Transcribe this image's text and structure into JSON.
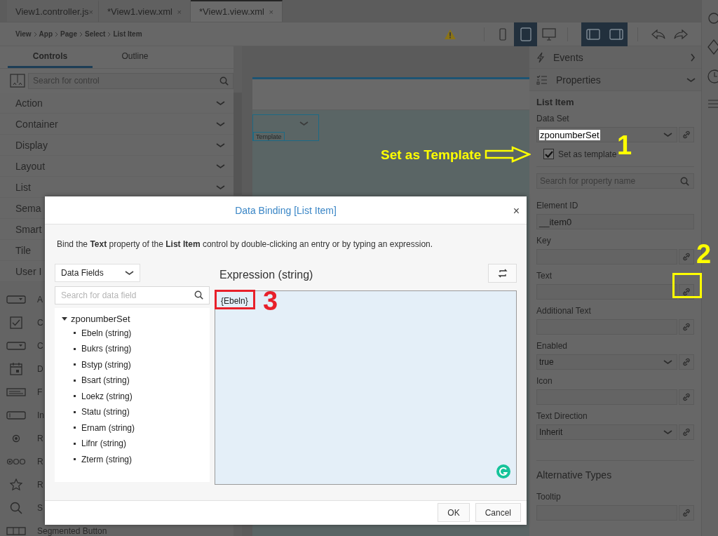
{
  "editor_tabs": [
    {
      "label": "View1.controller.js",
      "close": "×",
      "selected": false
    },
    {
      "label": "*View1.view.xml",
      "close": "×",
      "selected": false
    },
    {
      "label": "*View1.view.xml",
      "close": "×",
      "selected": true
    }
  ],
  "breadcrumb": [
    "View",
    "App",
    "Page",
    "Select",
    "List Item"
  ],
  "toolbar": {
    "devices": [
      {
        "kind": "phone",
        "selected": false
      },
      {
        "kind": "tablet",
        "selected": true
      },
      {
        "kind": "desktop",
        "selected": false
      }
    ],
    "panes": [
      {
        "kind": "left",
        "selected": true
      },
      {
        "kind": "right",
        "selected": true
      }
    ]
  },
  "left_panel": {
    "tabs": [
      {
        "label": "Controls",
        "selected": true
      },
      {
        "label": "Outline",
        "selected": false
      }
    ],
    "search": {
      "placeholder": "Search for control"
    },
    "categories": [
      {
        "label": "Action",
        "chevron": true
      },
      {
        "label": "Container",
        "chevron": true
      },
      {
        "label": "Display",
        "chevron": true
      },
      {
        "label": "Layout",
        "chevron": true
      },
      {
        "label": "List",
        "chevron": true
      },
      {
        "label": "Sema",
        "chevron": false
      },
      {
        "label": "Smart",
        "chevron": false
      },
      {
        "label": "Tile",
        "chevron": false
      },
      {
        "label": "User I",
        "chevron": false
      }
    ],
    "controls": [
      {
        "kind": "select",
        "label": "A"
      },
      {
        "kind": "checkbox",
        "label": "C"
      },
      {
        "kind": "select",
        "label": "C"
      },
      {
        "kind": "date",
        "label": "D"
      },
      {
        "kind": "feed",
        "label": "F"
      },
      {
        "kind": "input",
        "label": "In"
      },
      {
        "kind": "radio",
        "label": "R"
      },
      {
        "kind": "radio-group",
        "label": "R"
      },
      {
        "kind": "rating",
        "label": "R"
      },
      {
        "kind": "search",
        "label": "S"
      },
      {
        "kind": "segmented",
        "label": "Segmented Button"
      }
    ]
  },
  "canvas": {
    "template_label": "Template"
  },
  "properties_panel": {
    "sections": [
      {
        "kind": "events",
        "label": "Events",
        "expanded": false
      },
      {
        "kind": "properties",
        "label": "Properties",
        "expanded": true
      }
    ],
    "heading": "List Item",
    "data_set": {
      "label": "Data Set",
      "value": "zponumberSet"
    },
    "template_checkbox": {
      "label": "Set as template",
      "checked": true
    },
    "search": {
      "placeholder": "Search for property name"
    },
    "properties": [
      {
        "kind": "plain",
        "label": "Element ID",
        "value": "__item0"
      },
      {
        "kind": "text",
        "label": "Key"
      },
      {
        "kind": "text",
        "label": "Text"
      },
      {
        "kind": "text",
        "label": "Additional Text"
      },
      {
        "kind": "select",
        "label": "Enabled",
        "value": "true"
      },
      {
        "kind": "text",
        "label": "Icon"
      },
      {
        "kind": "select",
        "label": "Text Direction",
        "value": "Inherit"
      }
    ],
    "alternative_types": {
      "heading": "Alternative Types",
      "properties": [
        {
          "kind": "text",
          "label": "Tooltip"
        }
      ]
    }
  },
  "dialog": {
    "title": "Data Binding [List Item]",
    "close": "×",
    "description": "Bind the **Text** property of the **List Item** control by double-clicking an entry or by typing an expression.",
    "source": "Data Fields",
    "search": {
      "placeholder": "Search for data field"
    },
    "tree": [
      {
        "label": "zponumberSet",
        "expanded": true,
        "children": [
          {
            "label": "Ebeln (string)"
          },
          {
            "label": "Bukrs (string)"
          },
          {
            "label": "Bstyp (string)"
          },
          {
            "label": "Bsart (string)"
          },
          {
            "label": "Loekz (string)"
          },
          {
            "label": "Statu (string)"
          },
          {
            "label": "Ernam (string)"
          },
          {
            "label": "Lifnr (string)"
          },
          {
            "label": "Zterm (string)"
          }
        ]
      }
    ],
    "expression": {
      "heading": "Expression (string)",
      "value": "{Ebeln}"
    },
    "buttons": [
      "OK",
      "Cancel"
    ]
  },
  "annotations": [
    {
      "kind": "arrow-label",
      "text": "Set as Template",
      "color": "#ffff00"
    },
    {
      "kind": "number",
      "text": "1",
      "color": "#ffff00"
    },
    {
      "kind": "number",
      "text": "2",
      "color": "#ffff00"
    },
    {
      "kind": "box",
      "color": "#ffff00"
    },
    {
      "kind": "box",
      "color": "#e8202a"
    },
    {
      "kind": "number",
      "text": "3",
      "color": "#e8202a"
    }
  ]
}
